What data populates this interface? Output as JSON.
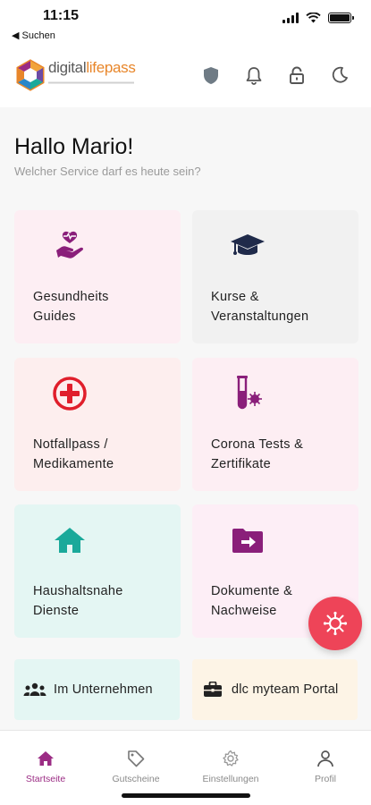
{
  "status_bar": {
    "time": "11:15",
    "back_label": "◀ Suchen"
  },
  "header": {
    "logo_digital": "digital",
    "logo_lifepass": "lifepass",
    "icons": [
      "shield-icon",
      "bell-icon",
      "unlock-icon",
      "moon-icon"
    ]
  },
  "greeting": {
    "title": "Hallo Mario!",
    "subtitle": "Welcher Service darf es heute sein?"
  },
  "tiles": [
    {
      "label": "Gesundheits\nGuides",
      "icon": "health-hand-icon",
      "bg": "#fdeef3"
    },
    {
      "label": "Kurse &\nVeranstaltungen",
      "icon": "graduation-cap-icon",
      "bg": "#f1f1f1"
    },
    {
      "label": "Notfallpass /\nMedikamente",
      "icon": "emergency-plus-icon",
      "bg": "#fdeeee"
    },
    {
      "label": "Corona Tests &\nZertifikate",
      "icon": "test-tube-icon",
      "bg": "#fdeef3"
    },
    {
      "label": "Haushaltsnahe\nDienste",
      "icon": "home-icon",
      "bg": "#e4f6f3"
    },
    {
      "label": "Dokumente &\nNachweise",
      "icon": "folder-arrow-icon",
      "bg": "#fdeef6"
    }
  ],
  "shortcuts": [
    {
      "label": "Im Unternehmen",
      "icon": "people-icon",
      "bg": "#e4f6f3"
    },
    {
      "label": "dlc myteam Portal",
      "icon": "briefcase-icon",
      "bg": "#fdf4e6"
    }
  ],
  "fab": {
    "icon": "virus-icon",
    "color": "#ee4458"
  },
  "bottom_nav": [
    {
      "label": "Startseite",
      "icon": "home-icon",
      "active": true
    },
    {
      "label": "Gutscheine",
      "icon": "tag-icon",
      "active": false
    },
    {
      "label": "Einstellungen",
      "icon": "gear-icon",
      "active": false
    },
    {
      "label": "Profil",
      "icon": "user-icon",
      "active": false
    }
  ],
  "colors": {
    "accent": "#9b2c84",
    "purple": "#8a1f7a",
    "red": "#e01e2b",
    "teal": "#1aa99a",
    "navy": "#1f2a4a"
  }
}
